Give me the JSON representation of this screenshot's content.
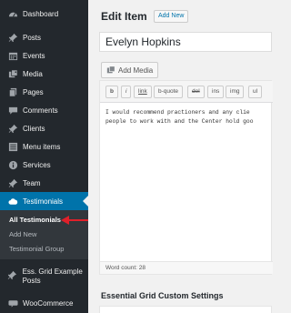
{
  "sidebar": {
    "items": [
      {
        "label": "Dashboard",
        "icon": "dashboard-icon"
      },
      {
        "label": "Posts",
        "icon": "pushpin-icon"
      },
      {
        "label": "Events",
        "icon": "calendar-icon"
      },
      {
        "label": "Media",
        "icon": "media-icon"
      },
      {
        "label": "Pages",
        "icon": "pages-icon"
      },
      {
        "label": "Comments",
        "icon": "comments-icon"
      },
      {
        "label": "Clients",
        "icon": "pushpin-icon"
      },
      {
        "label": "Menu items",
        "icon": "list-icon"
      },
      {
        "label": "Services",
        "icon": "info-icon"
      },
      {
        "label": "Team",
        "icon": "pushpin-icon"
      },
      {
        "label": "Testimonials",
        "icon": "cloud-icon"
      },
      {
        "label": "Ess. Grid Example Posts",
        "icon": "pushpin-icon"
      },
      {
        "label": "WooCommerce",
        "icon": "woocommerce-icon"
      }
    ],
    "submenu": [
      {
        "label": "All Testimonials"
      },
      {
        "label": "Add New"
      },
      {
        "label": "Testimonial Group"
      }
    ]
  },
  "main": {
    "page_title": "Edit Item",
    "add_new_label": "Add New",
    "title_value": "Evelyn Hopkins",
    "add_media_label": "Add Media",
    "toolbar": [
      "b",
      "i",
      "link",
      "b-quote",
      "del",
      "ins",
      "img",
      "ul"
    ],
    "content_lines": [
      "I would recommend practioners and any clie",
      "people to work with and the Center hold goo"
    ],
    "word_count": "Word count: 28",
    "panel_title": "Essential Grid Custom Settings"
  },
  "colors": {
    "sidebar_bg": "#23282d",
    "submenu_bg": "#32373c",
    "accent": "#0073aa",
    "annotation": "#e0202a"
  }
}
